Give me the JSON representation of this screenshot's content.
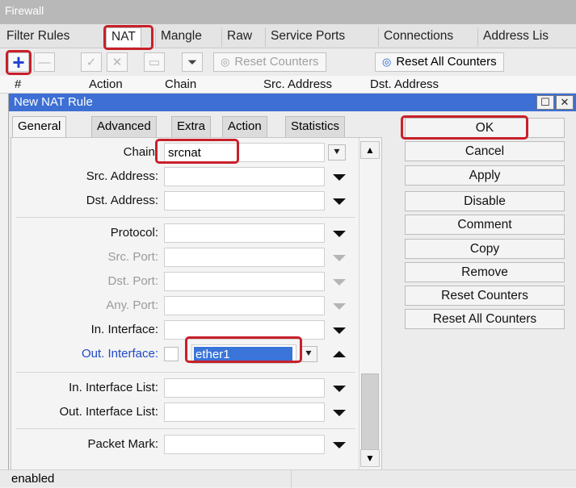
{
  "window": {
    "title": "Firewall"
  },
  "tabs": [
    "Filter Rules",
    "NAT",
    "Mangle",
    "Raw",
    "Service Ports",
    "Connections",
    "Address Lis"
  ],
  "toolbar": {
    "reset_counters": "Reset Counters",
    "reset_all_counters": "Reset All Counters",
    "icons": [
      "plus-icon",
      "minus-icon",
      "check-icon",
      "x-icon",
      "note-icon",
      "filter-icon"
    ]
  },
  "columns": [
    "#",
    "Action",
    "Chain",
    "Src. Address",
    "Dst. Address"
  ],
  "dialog": {
    "title": "New NAT Rule",
    "tabs": [
      "General",
      "Advanced",
      "Extra",
      "Action",
      "Statistics"
    ],
    "fields": {
      "chain": {
        "label": "Chain:",
        "value": "srcnat"
      },
      "src_address": {
        "label": "Src. Address:",
        "value": ""
      },
      "dst_address": {
        "label": "Dst. Address:",
        "value": ""
      },
      "protocol": {
        "label": "Protocol:",
        "value": ""
      },
      "src_port": {
        "label": "Src. Port:",
        "value": ""
      },
      "dst_port": {
        "label": "Dst. Port:",
        "value": ""
      },
      "any_port": {
        "label": "Any. Port:",
        "value": ""
      },
      "in_interface": {
        "label": "In. Interface:",
        "value": ""
      },
      "out_interface": {
        "label": "Out. Interface:",
        "value": "ether1"
      },
      "in_interface_list": {
        "label": "In. Interface List:",
        "value": ""
      },
      "out_interface_list": {
        "label": "Out. Interface List:",
        "value": ""
      },
      "packet_mark": {
        "label": "Packet Mark:",
        "value": ""
      }
    },
    "buttons": [
      "OK",
      "Cancel",
      "Apply",
      "Disable",
      "Comment",
      "Copy",
      "Remove",
      "Reset Counters",
      "Reset All Counters"
    ]
  },
  "status": {
    "text": "enabled"
  }
}
